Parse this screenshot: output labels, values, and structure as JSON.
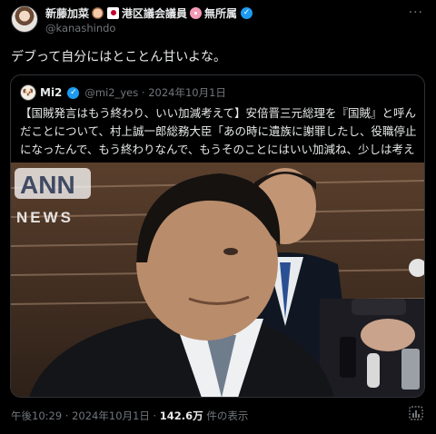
{
  "author": {
    "name": "新藤加菜",
    "suffix": "港区議会議員",
    "suffix2": "無所属",
    "handle": "@kanashindo"
  },
  "tweet_text": "デブって自分にはとことん甘いよな。",
  "quote": {
    "name": "Mi2",
    "handle_date": "@mi2_yes · 2024年10月1日",
    "text": "【国賊発言はもう終わり、いい加減考えて】安倍晋三元総理を『国賊』と呼んだことについて、村上誠一郎総務大臣「あの時に遺族に謝罪したし、役職停止になったんで、もう終わりなんで、もうそのことにはいい加減ね、少しは考えて」",
    "media": {
      "logo_main": "ANN",
      "logo_sub": "NEWS"
    }
  },
  "footer": {
    "time_date": "午後10:29 · 2024年10月1日 · ",
    "views": "142.6万",
    "views_label": " 件の表示"
  },
  "icons": {
    "more": "more-icon",
    "verified": "verified-badge-icon",
    "stats": "stats-icon"
  },
  "colors": {
    "background": "#000000",
    "text": "#e7e9ea",
    "secondary": "#71767b",
    "accent": "#1d9bf0",
    "border": "#2f3336"
  }
}
